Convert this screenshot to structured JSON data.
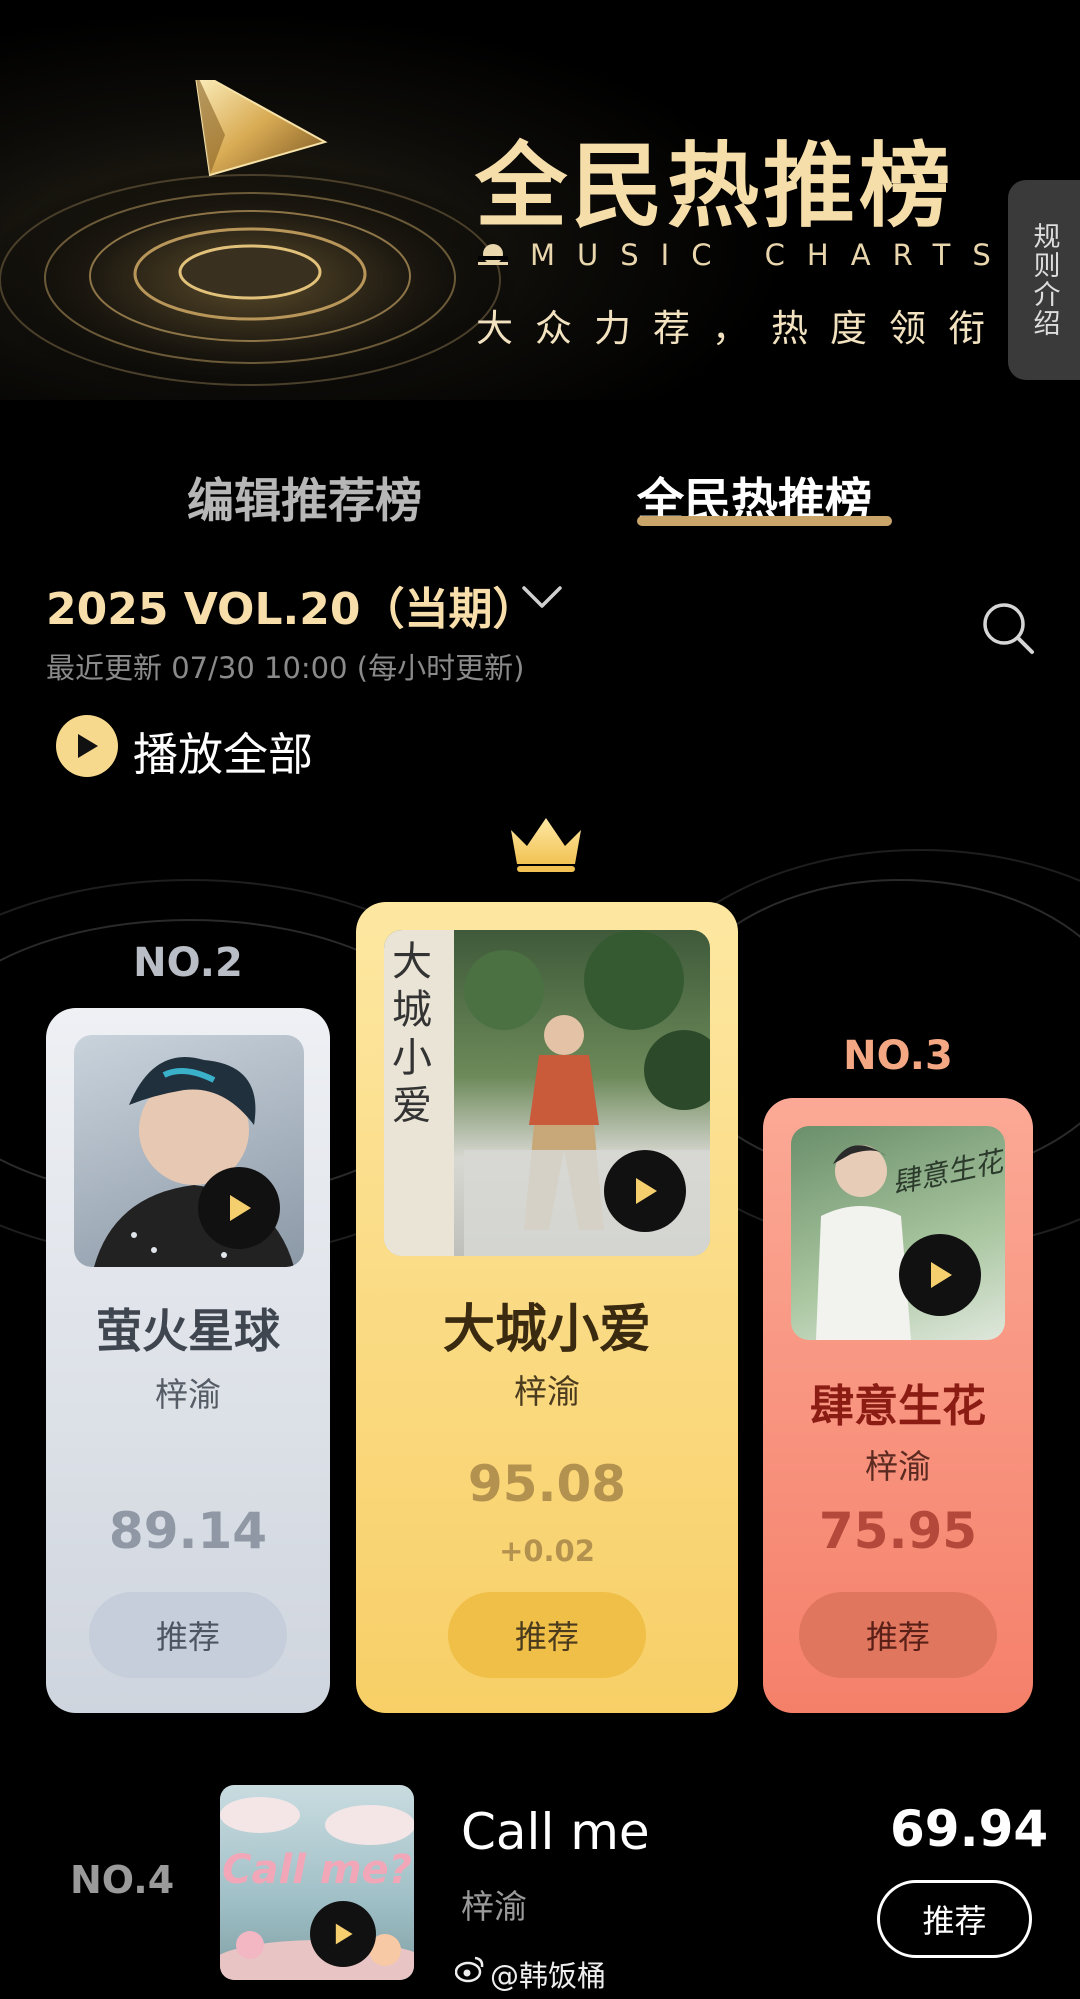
{
  "header": {
    "title": "全民热推榜",
    "subtitle_en": "MUSIC CHARTS",
    "slogan": "大众力荐，热度领衔",
    "rules_button": "规则介绍"
  },
  "tabs": [
    {
      "label": "编辑推荐榜",
      "active": false
    },
    {
      "label": "全民热推榜",
      "active": true
    }
  ],
  "period": {
    "label": "2025 VOL.20（当期）",
    "updated": "最近更新 07/30 10:00 (每小时更新)"
  },
  "play_all": "播放全部",
  "top3": [
    {
      "rank": "NO.2",
      "song": "萤火星球",
      "artist": "梓渝",
      "score": "89.14",
      "button": "推荐",
      "cover_text": ""
    },
    {
      "rank": "NO.1",
      "song": "大城小爱",
      "artist": "梓渝",
      "score": "95.08",
      "change": "+0.02",
      "button": "推荐",
      "cover_text": "大城小爱"
    },
    {
      "rank": "NO.3",
      "song": "肆意生花",
      "artist": "梓渝",
      "score": "75.95",
      "button": "推荐",
      "cover_text": "肆意生花"
    }
  ],
  "list": [
    {
      "rank": "NO.4",
      "song": "Call me",
      "artist": "梓渝",
      "score": "69.94",
      "button": "推荐",
      "cover_text": "Call me?"
    }
  ],
  "watermark": "@韩饭桶",
  "colors": {
    "gold": "#f6deaa",
    "accent": "#caa56a",
    "card_silver": "#dfe3ea",
    "card_gold": "#fbdc85",
    "card_bronze": "#f99984"
  },
  "icons": [
    "play-logo-icon",
    "sun-icon",
    "chevron-down-icon",
    "search-icon",
    "play-icon",
    "crown-icon",
    "weibo-icon"
  ]
}
